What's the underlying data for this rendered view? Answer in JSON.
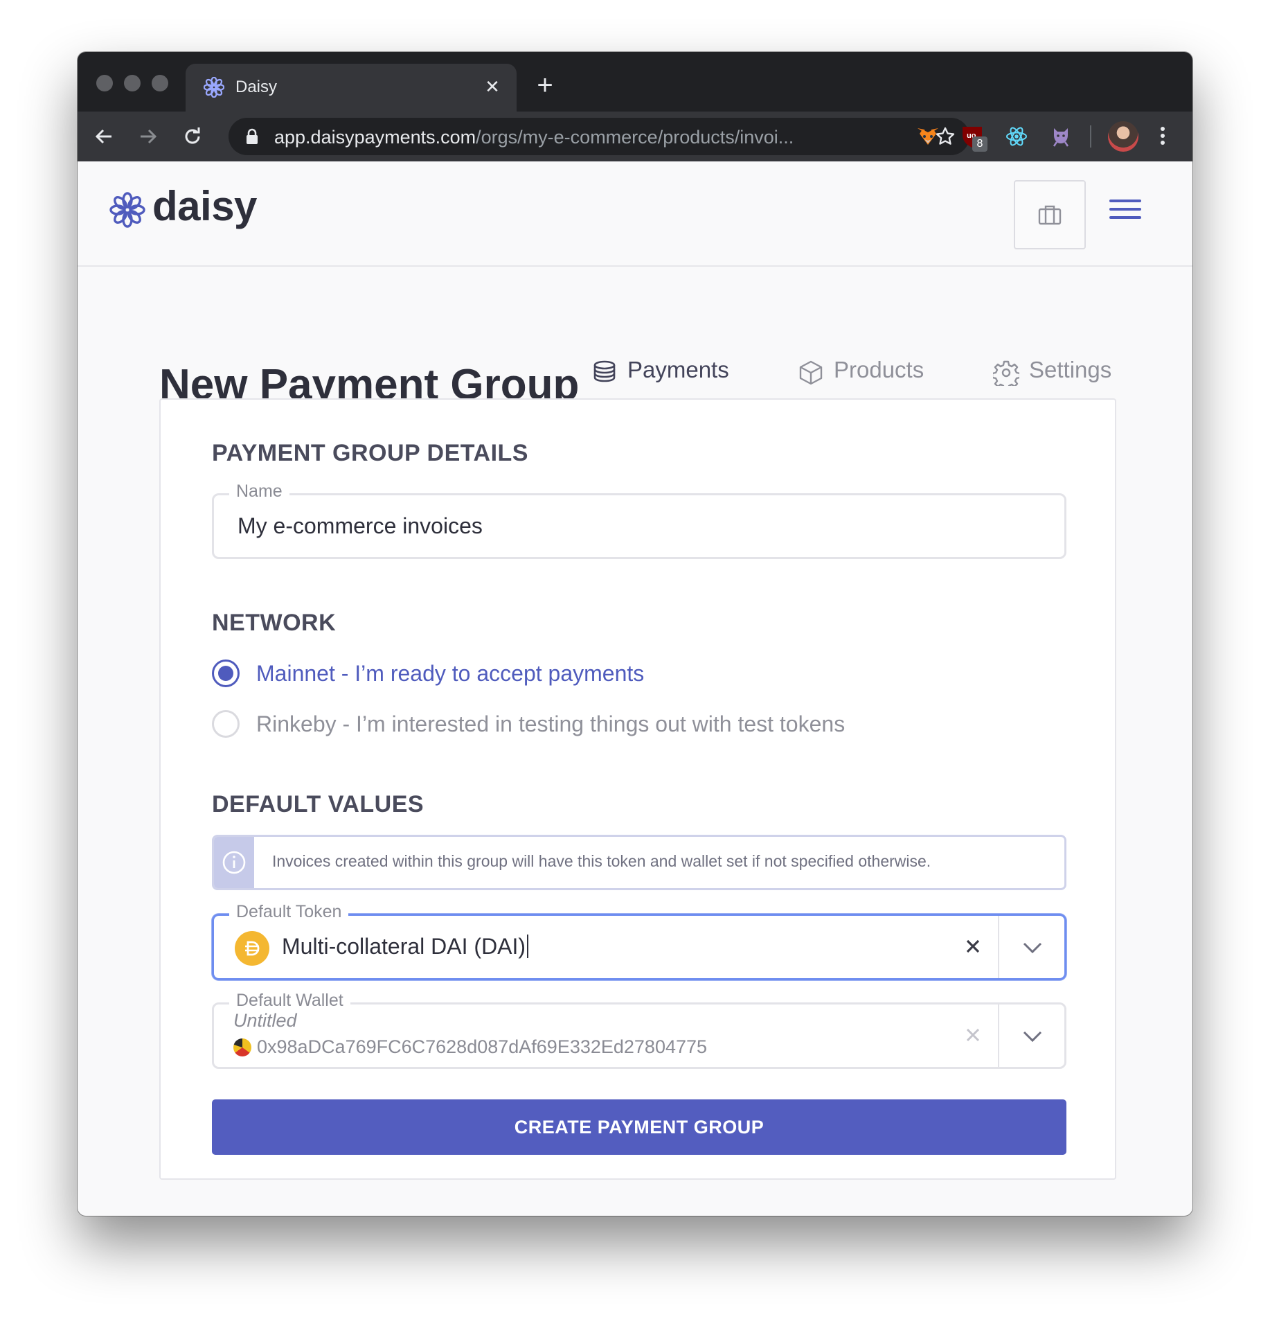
{
  "browser": {
    "tab_title": "Daisy",
    "new_tab": "+",
    "tab_close": "✕",
    "url_host": "app.daisypayments.com",
    "url_path": "/orgs/my-e-commerce/products/invoi...",
    "extensions": [
      "metamask-fox-icon",
      "ublock-icon",
      "react-devtools-icon",
      "github-cat-icon"
    ],
    "ublock_badge": "8"
  },
  "header": {
    "logo_text": "daisy"
  },
  "page": {
    "title": "New Payment Group",
    "tabs": [
      {
        "label": "Payments",
        "active": true
      },
      {
        "label": "Products",
        "active": false
      },
      {
        "label": "Settings",
        "active": false
      }
    ]
  },
  "form": {
    "details_title": "PAYMENT GROUP DETAILS",
    "name_label": "Name",
    "name_value": "My e-commerce invoices",
    "network_title": "NETWORK",
    "network_options": [
      {
        "label": "Mainnet - I’m ready to accept payments",
        "checked": true
      },
      {
        "label": "Rinkeby - I’m interested in testing things out with test tokens",
        "checked": false
      }
    ],
    "defaults_title": "DEFAULT VALUES",
    "info_text": "Invoices created within this group will have this token and wallet set if not specified otherwise.",
    "token_label": "Default Token",
    "token_value": "Multi-collateral DAI (DAI)",
    "wallet_label": "Default Wallet",
    "wallet_name": "Untitled",
    "wallet_address": "0x98aDCa769FC6C7628d087dAf69E332Ed27804775",
    "submit_label": "CREATE PAYMENT GROUP"
  },
  "colors": {
    "accent": "#4f5bbd",
    "button": "#535dbf",
    "dai": "#f4b731",
    "chrome_dark": "#202124"
  }
}
